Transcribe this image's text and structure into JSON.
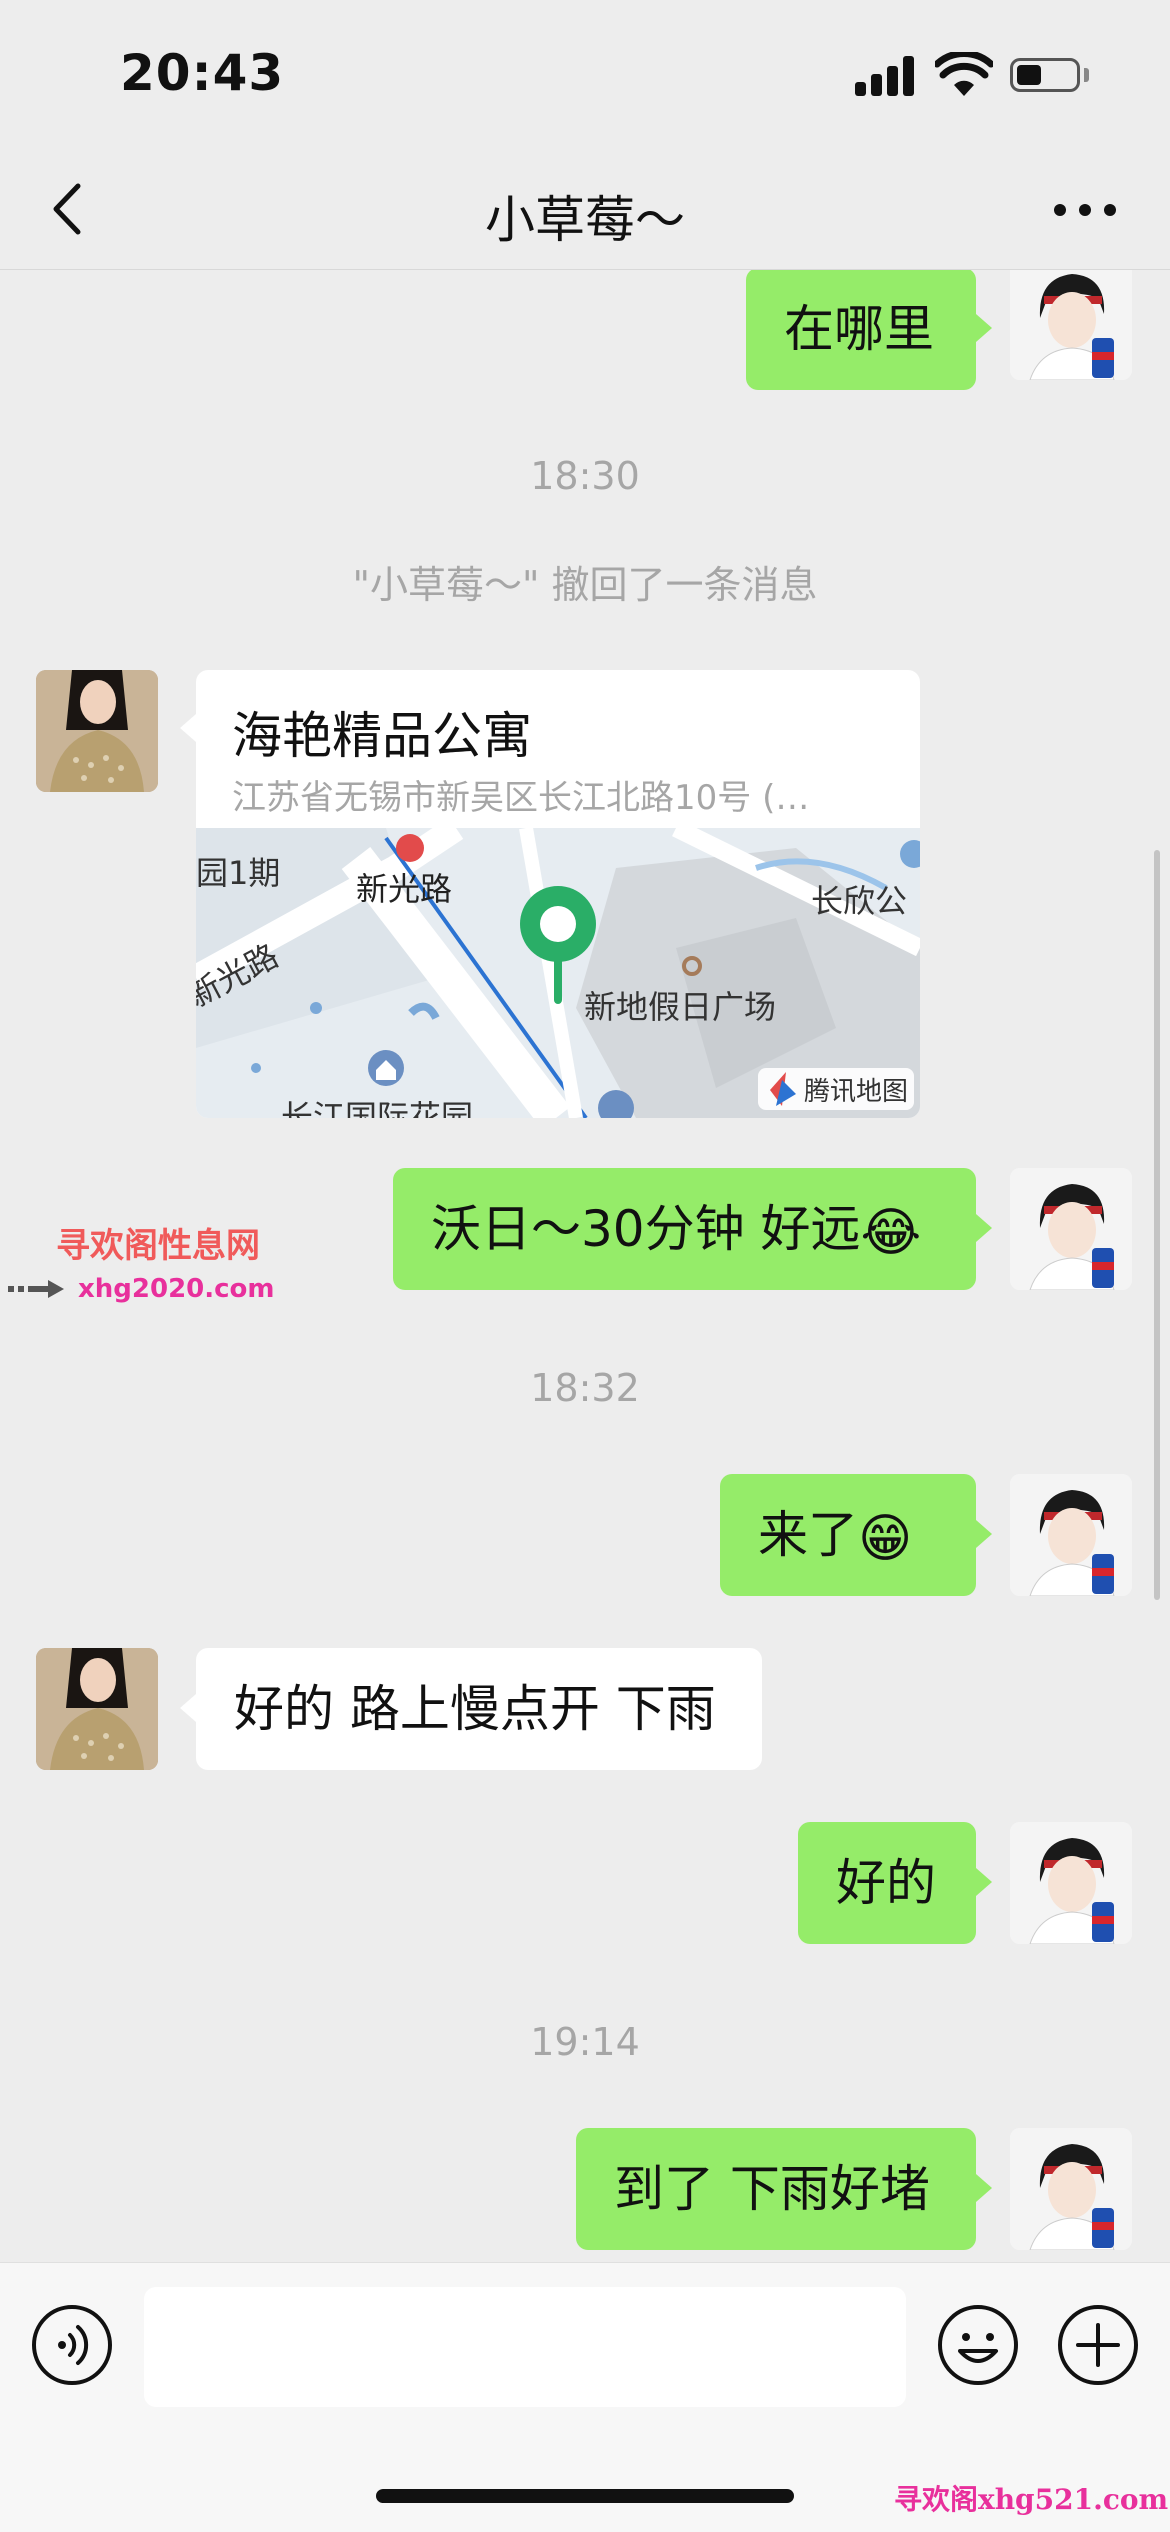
{
  "status_bar": {
    "time": "20:43"
  },
  "nav": {
    "title": "小草莓～"
  },
  "messages": {
    "m1": "在哪里",
    "ts1": "18:30",
    "recall_notice": "\"小草莓～\" 撤回了一条消息",
    "location": {
      "title": "海艳精品公寓",
      "address": "江苏省无锡市新吴区长江北路10号 (…",
      "map_labels": {
        "phase": "园1期",
        "station": "新光路",
        "road": "新光路",
        "plaza": "新地假日广场",
        "east": "长欣公",
        "garden": "长江国际花园",
        "brand": "腾讯地图"
      }
    },
    "m2_text": "沃日～30分钟 好远",
    "m2_emoji": "😂",
    "ts2": "18:32",
    "m3_text": "来了",
    "m3_emoji": "😁",
    "m4": "好的 路上慢点开 下雨",
    "m5": "好的",
    "ts3": "19:14",
    "m6": "到了 下雨好堵"
  },
  "watermark": {
    "title": "寻欢阁性息网",
    "url": "xhg2020.com",
    "bottom": "寻欢阁xhg521.com"
  },
  "input": {
    "value": "",
    "placeholder": ""
  },
  "colors": {
    "bubble_me": "#95ec69",
    "bubble_her": "#ffffff",
    "background": "#ededed",
    "map_pin": "#2aae67"
  },
  "icons": {
    "back": "chevron-left-icon",
    "more": "more-dots-icon",
    "voice": "voice-icon",
    "emoji": "smiley-icon",
    "plus": "plus-icon",
    "pin": "map-pin-icon"
  }
}
